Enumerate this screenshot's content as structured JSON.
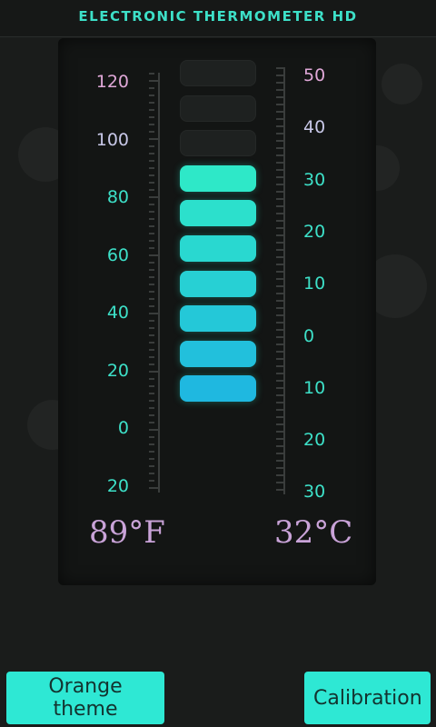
{
  "header": {
    "title": "ELECTRONIC THERMOMETER HD"
  },
  "scale_fahrenheit": {
    "labels": [
      "120",
      "100",
      "80",
      "60",
      "40",
      "20",
      "0",
      "20"
    ]
  },
  "scale_celsius": {
    "labels": [
      "50",
      "40",
      "30",
      "20",
      "10",
      "0",
      "10",
      "20",
      "30"
    ]
  },
  "thermometer": {
    "segments_total": 10,
    "segments_lit": 7
  },
  "readings": {
    "fahrenheit": "89°F",
    "celsius": "32°C"
  },
  "buttons": {
    "theme": "Orange theme",
    "calibration": "Calibration"
  },
  "colors": {
    "accent": "#2ee8d4",
    "lilac": "#c9a3d8",
    "teal_text": "#3de0c8",
    "blue_seg": "#1fb8e0"
  }
}
